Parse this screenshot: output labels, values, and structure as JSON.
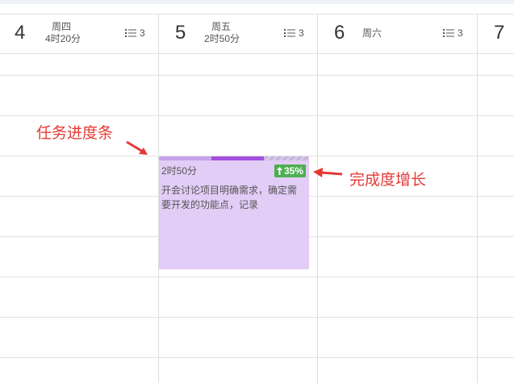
{
  "days": [
    {
      "num": "4",
      "weekday": "周四",
      "duration": "4时20分",
      "task_count": "3"
    },
    {
      "num": "5",
      "weekday": "周五",
      "duration": "2时50分",
      "task_count": "3"
    },
    {
      "num": "6",
      "weekday": "周六",
      "duration": "",
      "task_count": "3"
    },
    {
      "num": "7"
    }
  ],
  "event": {
    "duration": "2时50分",
    "progress_badge": "35%",
    "description": "开会讨论项目明确需求，确定需要开发的功能点，记录",
    "progress_fraction": 0.35,
    "progress_increase_fraction": 0.35,
    "color": "#e2cdf6"
  },
  "annotations": {
    "progress_bar_label": "任务进度条",
    "increase_label": "完成度增长",
    "color": "#e53935"
  },
  "icons": {
    "task_list": "list-icon",
    "increase": "up-arrow-icon"
  }
}
